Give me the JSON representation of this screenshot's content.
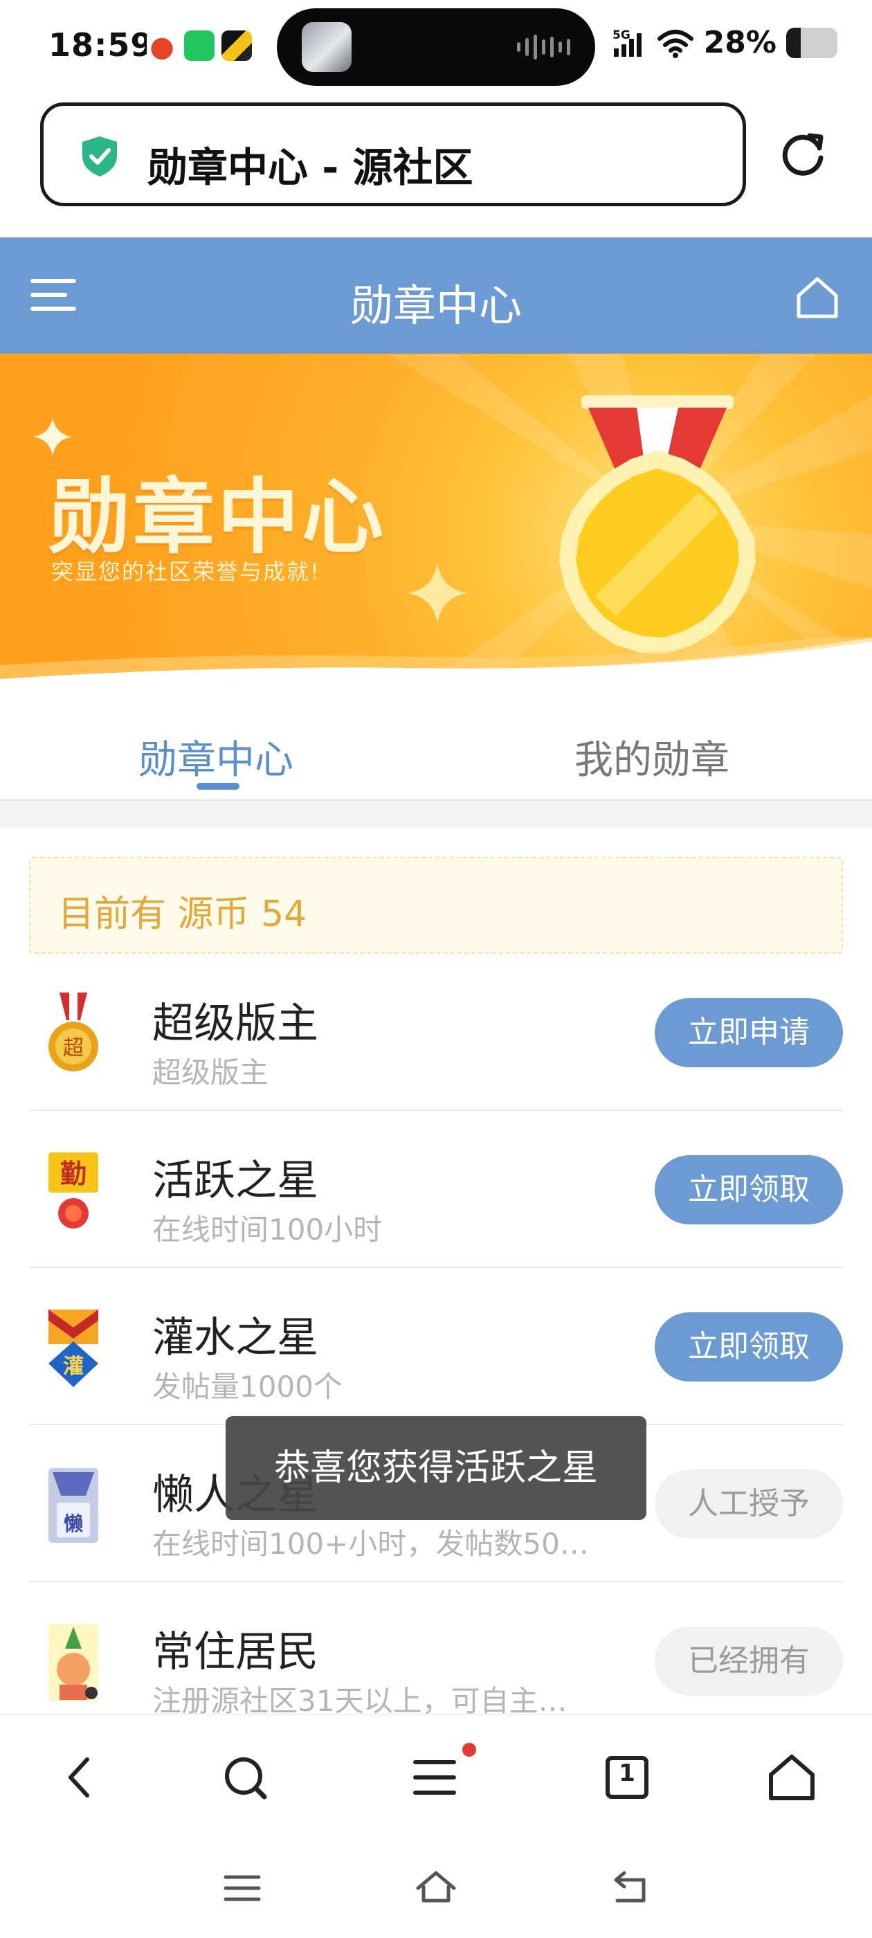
{
  "status_bar": {
    "time": "18:59",
    "network": "5G",
    "battery_percent": "28%",
    "battery_level": 0.28
  },
  "url_bar": {
    "title": "勋章中心 - 源社区"
  },
  "header": {
    "title": "勋章中心"
  },
  "banner": {
    "title": "勋章中心",
    "subtitle": "突显您的社区荣誉与成就!"
  },
  "tabs": [
    {
      "label": "勋章中心",
      "active": true
    },
    {
      "label": "我的勋章",
      "active": false
    }
  ],
  "coins": {
    "text": "目前有 源币 54"
  },
  "badges": [
    {
      "name": "超级版主",
      "description": "超级版主",
      "button": "立即申请",
      "style": "primary"
    },
    {
      "name": "活跃之星",
      "description": "在线时间100小时",
      "button": "立即领取",
      "style": "primary"
    },
    {
      "name": "灌水之星",
      "description": "发帖量1000个",
      "button": "立即领取",
      "style": "primary"
    },
    {
      "name": "懒人之星",
      "description": "在线时间100+小时，发帖数50…",
      "button": "人工授予",
      "style": "muted"
    },
    {
      "name": "常住居民",
      "description": "注册源社区31天以上，可自主…",
      "button": "已经拥有",
      "style": "muted"
    }
  ],
  "toast": {
    "message": "恭喜您获得活跃之星"
  },
  "browser_nav": {
    "tab_count": "1"
  },
  "colors": {
    "header_blue": "#6b9bd2",
    "accent_blue": "#5b8fcb",
    "coin_text": "#e4a73a",
    "banner_orange": "#ffb02a"
  }
}
